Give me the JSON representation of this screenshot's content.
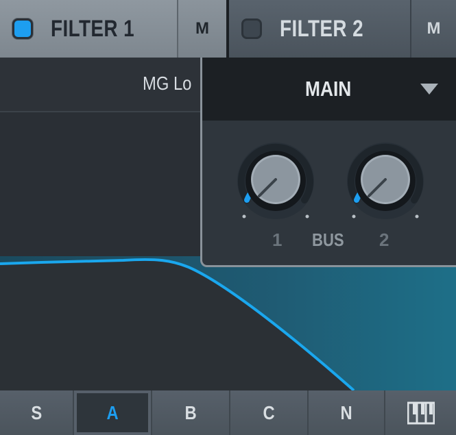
{
  "header": {
    "filter1": {
      "label": "FILTER 1",
      "enabled": true,
      "mute_label": "M"
    },
    "filter2": {
      "label": "FILTER 2",
      "enabled": false,
      "mute_label": "M"
    }
  },
  "param": {
    "label": "MG Lo"
  },
  "popup": {
    "title": "MAIN",
    "knob1_label": "1",
    "knob2_label": "2",
    "bus_label": "BUS",
    "knob1_value": 0.0,
    "knob2_value": 0.0
  },
  "bottom_tabs": [
    {
      "label": "S",
      "active": false
    },
    {
      "label": "A",
      "active": true
    },
    {
      "label": "B",
      "active": false
    },
    {
      "label": "C",
      "active": false
    },
    {
      "label": "N",
      "active": false
    }
  ],
  "piano_icon": "piano-keys-icon",
  "colors": {
    "accent": "#1d9ef0",
    "curve": "#1aa7ee",
    "fill": "#1f5b73"
  }
}
